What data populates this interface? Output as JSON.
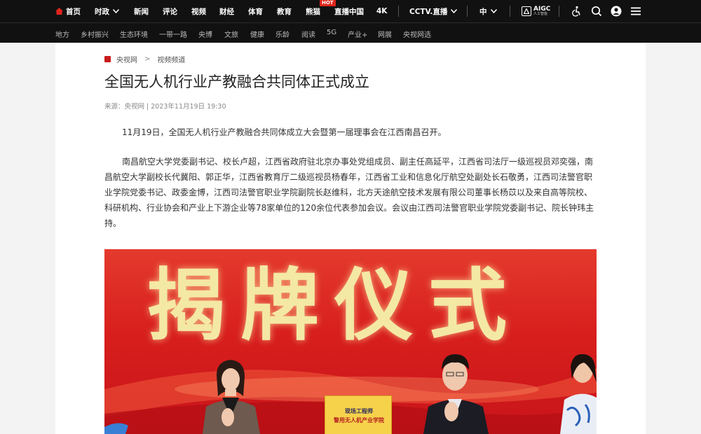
{
  "topnav": {
    "items": [
      "首页",
      "时政",
      "新闻",
      "评论",
      "视频",
      "财经",
      "体育",
      "教育",
      "熊猫",
      "直播中国",
      "4K",
      "CCTV.直播",
      "中"
    ],
    "hot_badge": "HOT",
    "aigc": {
      "label": "AIGC",
      "sub": "人工智能"
    },
    "accent": "#e1251b"
  },
  "subnav": {
    "items": [
      "地方",
      "乡村振兴",
      "生态环境",
      "一带一路",
      "央博",
      "文旅",
      "健康",
      "乐龄",
      "阅读",
      "5G",
      "产业+",
      "网展",
      "央视网选"
    ]
  },
  "breadcrumb": {
    "site": "央视网",
    "separator": ">",
    "section": "视频频道"
  },
  "article": {
    "title": "全国无人机行业产教融合共同体正式成立",
    "meta": "来源：央视网 | 2023年11月19日 19:30",
    "paragraphs": [
      "11月19日，全国无人机行业产教融合共同体成立大会暨第一届理事会在江西南昌召开。",
      "南昌航空大学党委副书记、校长卢超，江西省政府驻北京办事处党组成员、副主任高延平，江西省司法厅一级巡视员邓奕强，南昌航空大学副校长代冀阳、郭正华，江西省教育厅二级巡视员杨春年，江西省工业和信息化厅航空处副处长石敬勇，江西司法警官职业学院党委书记、政委金博，江西司法警官职业学院副院长赵维科，北方天途航空技术发展有限公司董事长杨苡以及来自高等院校、科研机构、行业协会和产业上下游企业等78家单位的120余位代表参加会议。会议由江西司法警官职业学院党委副书记、院长钟玮主持。"
    ]
  },
  "photo": {
    "banner": "揭牌仪式",
    "plaque_line1": "现场工程师",
    "plaque_line2": "警用无人机产业学院"
  }
}
